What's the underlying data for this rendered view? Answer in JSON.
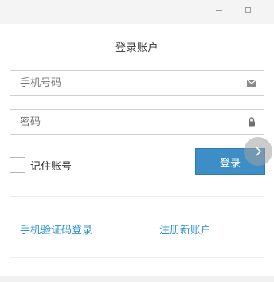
{
  "window": {
    "controls": {
      "minimize_icon": "minimize-icon",
      "maximize_icon": "maximize-icon"
    }
  },
  "login": {
    "title": "登录账户",
    "phone_placeholder": "手机号码",
    "phone_icon": "envelope-icon",
    "password_placeholder": "密码",
    "password_icon": "lock-icon",
    "remember_label": "记住账号",
    "remember_checked": false,
    "submit_label": "登录",
    "next_icon": "chevron-right-icon",
    "sms_login_link": "手机验证码登录",
    "register_link": "注册新账户"
  },
  "colors": {
    "primary": "#3d8ec6",
    "link": "#2d8fd0",
    "border": "#cfcfcf",
    "titlebar": "#f4f4f4"
  }
}
